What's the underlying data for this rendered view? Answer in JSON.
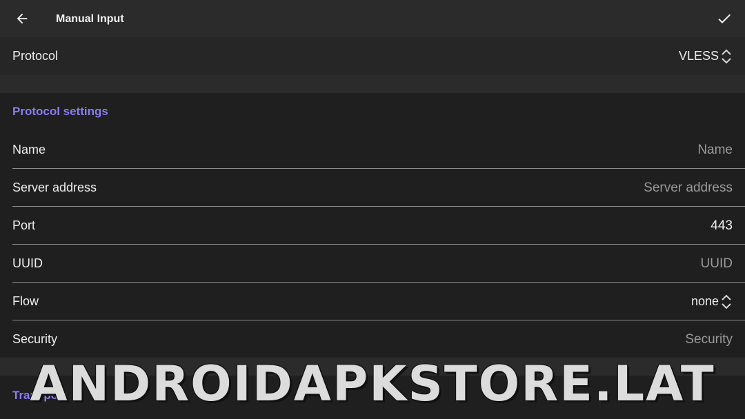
{
  "header": {
    "title": "Manual Input",
    "back_icon": "arrow-left-icon",
    "confirm_icon": "check-icon"
  },
  "protocol": {
    "label": "Protocol",
    "value": "VLESS"
  },
  "protocol_settings": {
    "section_title": "Protocol settings",
    "fields": {
      "name": {
        "label": "Name",
        "placeholder": "Name",
        "value": ""
      },
      "server_address": {
        "label": "Server address",
        "placeholder": "Server address",
        "value": ""
      },
      "port": {
        "label": "Port",
        "value": "443"
      },
      "uuid": {
        "label": "UUID",
        "placeholder": "UUID",
        "value": ""
      },
      "flow": {
        "label": "Flow",
        "value": "none"
      },
      "security": {
        "label": "Security",
        "placeholder": "Security",
        "value": ""
      }
    }
  },
  "transport": {
    "section_title": "Transport"
  },
  "watermark": "ANDROIDAPKSTORE.LAT",
  "colors": {
    "background": "#1f1f1f",
    "topbar": "#2b2b2b",
    "accent": "#8b7cf6",
    "divider": "#8d8d8d",
    "placeholder": "#9a9a9a"
  }
}
